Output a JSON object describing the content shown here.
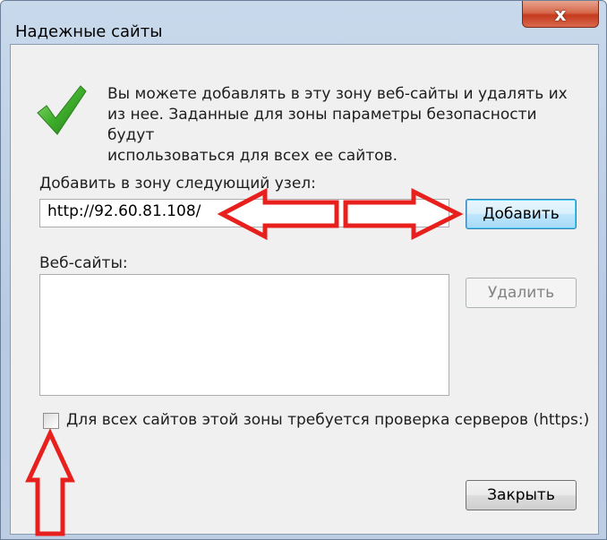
{
  "window": {
    "title": "Надежные сайты",
    "close_glyph": "x"
  },
  "info": {
    "icon": "green-checkmark-icon",
    "text": "Вы можете добавлять в эту зону  веб-сайты и удалять их\nиз нее. Заданные для зоны параметры безопасности будут\nиспользоваться для всех ее сайтов."
  },
  "add_site": {
    "label": "Добавить в зону следующий узел:",
    "value": "http://92.60.81.108/",
    "button": "Добавить"
  },
  "websites": {
    "label": "Веб-сайты:",
    "items": [],
    "remove_button": "Удалить"
  },
  "require_https": {
    "label": "Для всех сайтов этой зоны требуется проверка серверов (https:)",
    "checked": false
  },
  "footer": {
    "close_button": "Закрыть"
  },
  "annotations": {
    "arrow_color": "#e8201d"
  }
}
